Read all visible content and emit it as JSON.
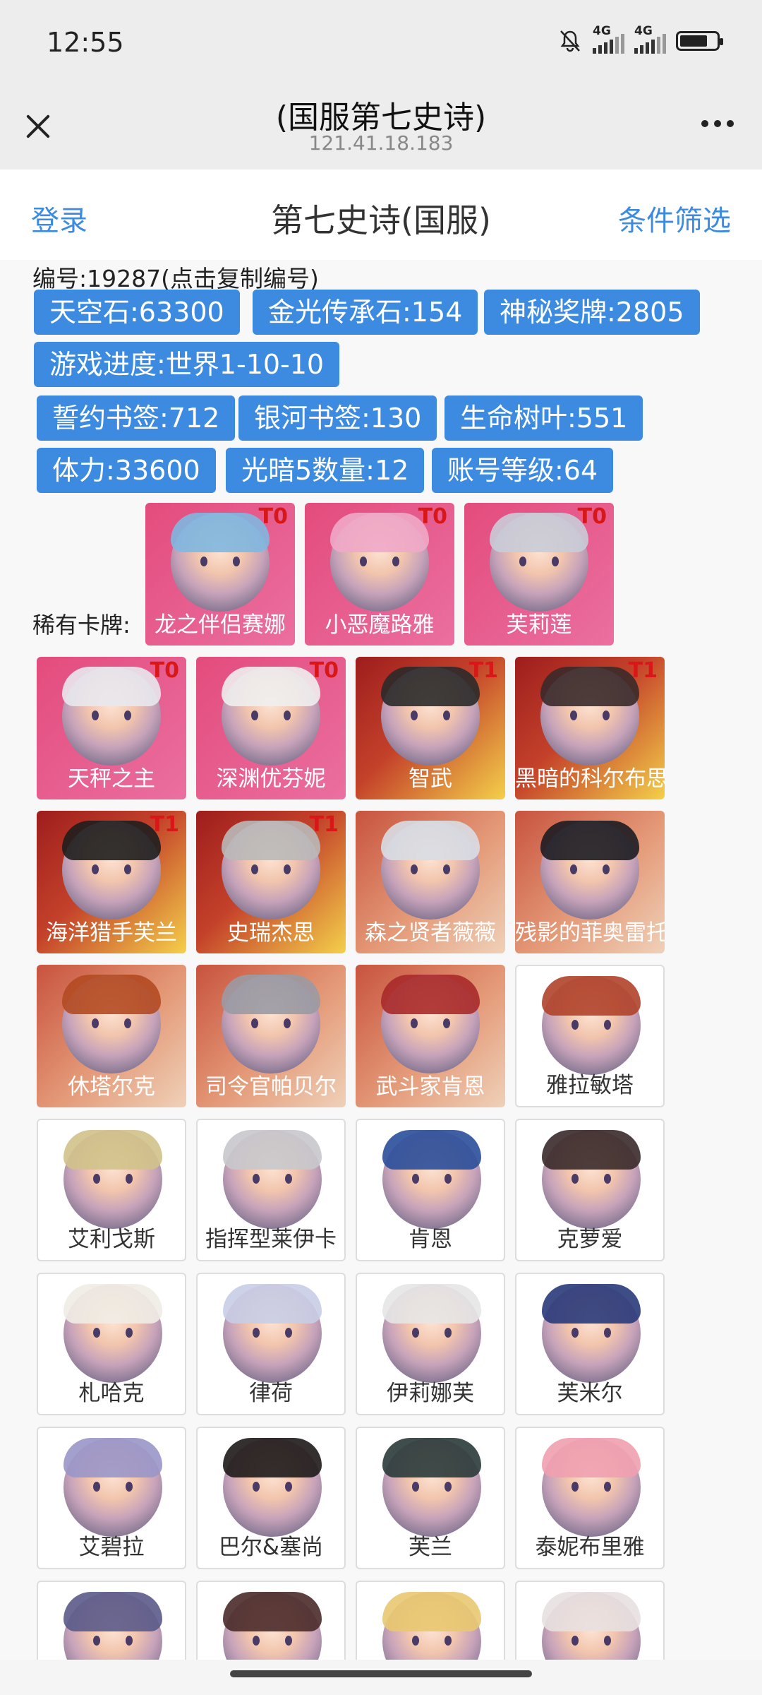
{
  "status": {
    "time": "12:55",
    "net1": "4G",
    "net2": "4G"
  },
  "titlebar": {
    "title": "(国服第七史诗)",
    "url": "121.41.18.183"
  },
  "header": {
    "login": "登录",
    "title": "第七史诗(国服)",
    "filter": "条件筛选"
  },
  "account": {
    "id_line": "编号:19287(点击复制编号)",
    "tags": [
      "天空石:63300",
      "金光传承石:154",
      "神秘奖牌:2805",
      "游戏进度:世界1-10-10",
      "誓约书签:712",
      "银河书签:130",
      "生命树叶:551",
      "体力:33600",
      "光暗5数量:12",
      "账号等级:64"
    ]
  },
  "rare_label": "稀有卡牌:",
  "rare_cards": [
    {
      "name": "龙之伴侣赛娜",
      "tier": "T0",
      "style": "pink",
      "hair": "#7fb7e0"
    },
    {
      "name": "小恶魔路雅",
      "tier": "T0",
      "style": "pink",
      "hair": "#f0a8c8"
    },
    {
      "name": "芙莉莲",
      "tier": "T0",
      "style": "pink",
      "hair": "#c9ccd8"
    }
  ],
  "cards": [
    {
      "name": "天秤之主",
      "tier": "T0",
      "style": "pink",
      "hair": "#e8e8ee"
    },
    {
      "name": "深渊优芬妮",
      "tier": "T0",
      "style": "pink",
      "hair": "#eeeeee"
    },
    {
      "name": "智武",
      "tier": "T1",
      "style": "gold",
      "hair": "#2a2a2a"
    },
    {
      "name": "黑暗的科尔布思",
      "tier": "T1",
      "style": "gold",
      "hair": "#3a2a2a"
    },
    {
      "name": "海洋猎手芙兰",
      "tier": "T1",
      "style": "gold",
      "hair": "#1e1e1e"
    },
    {
      "name": "史瑞杰思",
      "tier": "T1",
      "style": "gold",
      "hair": "#b9b9b9"
    },
    {
      "name": "森之贤者薇薇",
      "tier": "",
      "style": "peach",
      "hair": "#d8dde4"
    },
    {
      "name": "残影的菲奥雷托",
      "tier": "",
      "style": "peach",
      "hair": "#1c1c22"
    },
    {
      "name": "休塔尔克",
      "tier": "",
      "style": "peach",
      "hair": "#b24a22"
    },
    {
      "name": "司令官帕贝尔",
      "tier": "",
      "style": "peach",
      "hair": "#9a9aa4"
    },
    {
      "name": "武斗家肯恩",
      "tier": "",
      "style": "peach",
      "hair": "#a82a2a"
    },
    {
      "name": "雅拉敏塔",
      "tier": "",
      "style": "white",
      "hair": "#b0432a"
    },
    {
      "name": "艾利戈斯",
      "tier": "",
      "style": "white",
      "hair": "#d0c28a"
    },
    {
      "name": "指挥型莱伊卡",
      "tier": "",
      "style": "white",
      "hair": "#c8c8cc"
    },
    {
      "name": "肯恩",
      "tier": "",
      "style": "white",
      "hair": "#2a4e9a"
    },
    {
      "name": "克萝爱",
      "tier": "",
      "style": "white",
      "hair": "#3a2a2a"
    },
    {
      "name": "札哈克",
      "tier": "",
      "style": "white",
      "hair": "#f0ece6"
    },
    {
      "name": "律荷",
      "tier": "",
      "style": "white",
      "hair": "#c8cde6"
    },
    {
      "name": "伊莉娜芙",
      "tier": "",
      "style": "white",
      "hair": "#e6e6e6"
    },
    {
      "name": "芙米尔",
      "tier": "",
      "style": "white",
      "hair": "#2a3a7a"
    },
    {
      "name": "艾碧拉",
      "tier": "",
      "style": "white",
      "hair": "#9a96c8"
    },
    {
      "name": "巴尔&塞尚",
      "tier": "",
      "style": "white",
      "hair": "#1e1a1a"
    },
    {
      "name": "芙兰",
      "tier": "",
      "style": "white",
      "hair": "#2a3a3a"
    },
    {
      "name": "泰妮布里雅",
      "tier": "",
      "style": "white",
      "hair": "#f0a0b0"
    },
    {
      "name": "",
      "tier": "",
      "style": "white",
      "hair": "#5a5a8a"
    },
    {
      "name": "",
      "tier": "",
      "style": "white",
      "hair": "#4a2a2a"
    },
    {
      "name": "",
      "tier": "",
      "style": "white",
      "hair": "#e8c870"
    },
    {
      "name": "",
      "tier": "",
      "style": "white",
      "hair": "#e8e0e0"
    }
  ]
}
